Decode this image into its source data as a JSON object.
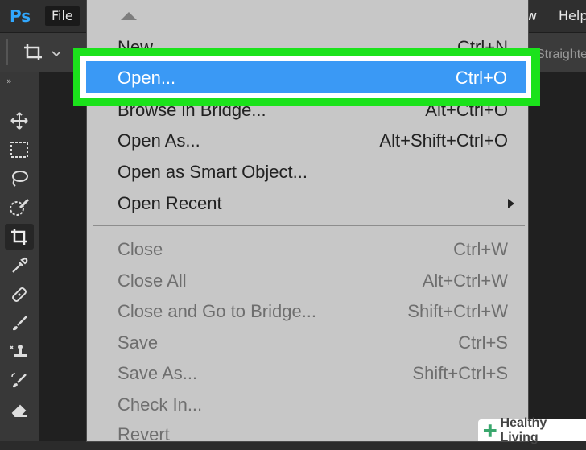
{
  "app": {
    "logo": "Ps",
    "menubar": {
      "file": "File",
      "window_partial": "w",
      "help_partial": "Help"
    },
    "options_bar": {
      "straighten_partial": "Straighte"
    }
  },
  "toolbar_icons": [
    "move-icon",
    "marquee-icon",
    "lasso-icon",
    "quick-selection-icon",
    "crop-icon",
    "eyedropper-icon",
    "healing-brush-icon",
    "brush-icon",
    "clone-stamp-icon",
    "history-brush-icon",
    "eraser-icon"
  ],
  "file_menu": {
    "items": [
      {
        "label": "New",
        "shortcut": "Ctrl+N",
        "enabled": true
      },
      {
        "label": "Open...",
        "shortcut": "Ctrl+O",
        "enabled": true,
        "highlighted": true
      },
      {
        "label": "Browse in Bridge...",
        "shortcut": "Alt+Ctrl+O",
        "enabled": true
      },
      {
        "label": "Open As...",
        "shortcut": "Alt+Shift+Ctrl+O",
        "enabled": true
      },
      {
        "label": "Open as Smart Object...",
        "shortcut": "",
        "enabled": true
      },
      {
        "label": "Open Recent",
        "shortcut": "",
        "enabled": true,
        "submenu": true
      },
      {
        "label": "Close",
        "shortcut": "Ctrl+W",
        "enabled": false
      },
      {
        "label": "Close All",
        "shortcut": "Alt+Ctrl+W",
        "enabled": false
      },
      {
        "label": "Close and Go to Bridge...",
        "shortcut": "Shift+Ctrl+W",
        "enabled": false
      },
      {
        "label": "Save",
        "shortcut": "Ctrl+S",
        "enabled": false
      },
      {
        "label": "Save As...",
        "shortcut": "Shift+Ctrl+S",
        "enabled": false
      },
      {
        "label": "Check In...",
        "shortcut": "",
        "enabled": false
      },
      {
        "label": "Revert",
        "shortcut": "",
        "enabled": false
      }
    ]
  },
  "colors": {
    "highlight": "#3a99f5",
    "annotation_frame": "#1be21b",
    "menu_bg": "#c7c7c7"
  },
  "watermark": {
    "text": "Healthy Living"
  }
}
